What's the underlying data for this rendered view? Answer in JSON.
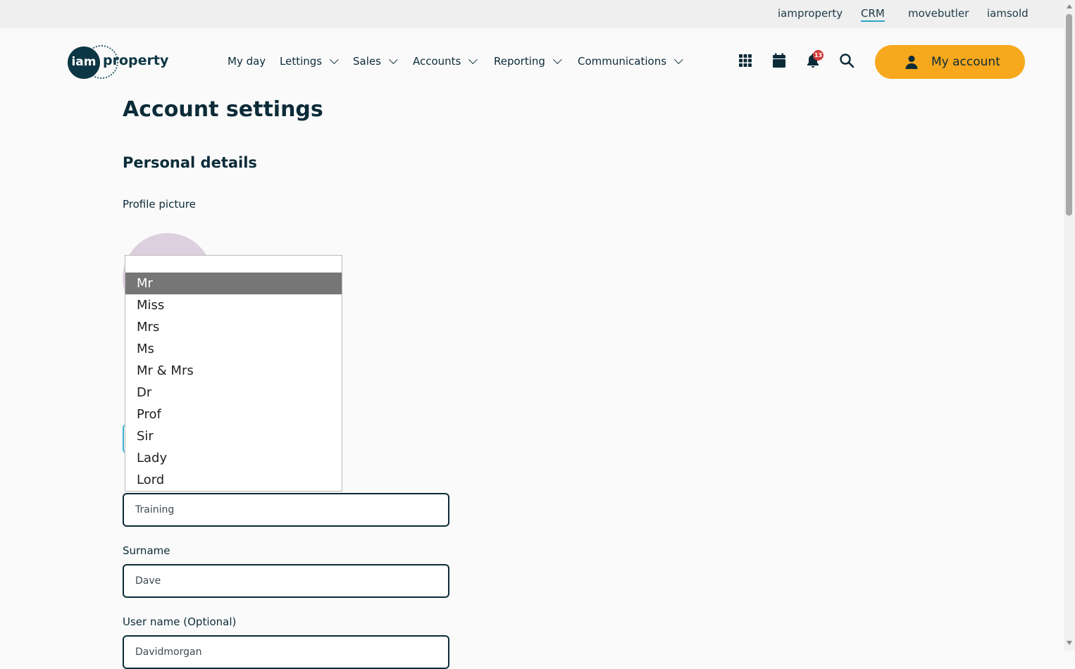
{
  "topbar": {
    "links": [
      "iamproperty",
      "CRM",
      "movebutler",
      "iamsold"
    ],
    "active": "CRM"
  },
  "logo": {
    "circle_text": "iam",
    "word": "property"
  },
  "nav": {
    "items": [
      "My day",
      "Lettings",
      "Sales",
      "Accounts",
      "Reporting",
      "Communications"
    ]
  },
  "header_icons": [
    "apps-grid-icon",
    "calendar-icon",
    "bell-icon",
    "search-icon"
  ],
  "notifications": {
    "count": "13"
  },
  "account_button": {
    "label": "My account",
    "icon": "person-icon"
  },
  "page": {
    "title": "Account settings",
    "section": "Personal details",
    "profile_picture_label": "Profile picture",
    "first_name_value": "Training",
    "surname_label": "Surname",
    "surname_value": "Dave",
    "username_label": "User name (Optional)",
    "username_value": "Davidmorgan"
  },
  "title_dropdown": {
    "selected": "Mr",
    "options": [
      "Mr",
      "Miss",
      "Mrs",
      "Ms",
      "Mr & Mrs",
      "Dr",
      "Prof",
      "Sir",
      "Lady",
      "Lord"
    ]
  },
  "colors": {
    "brand_dark": "#0c3643",
    "accent": "#f8a81c",
    "badge": "#d23a3a",
    "active_underline": "#2aa6c7"
  }
}
